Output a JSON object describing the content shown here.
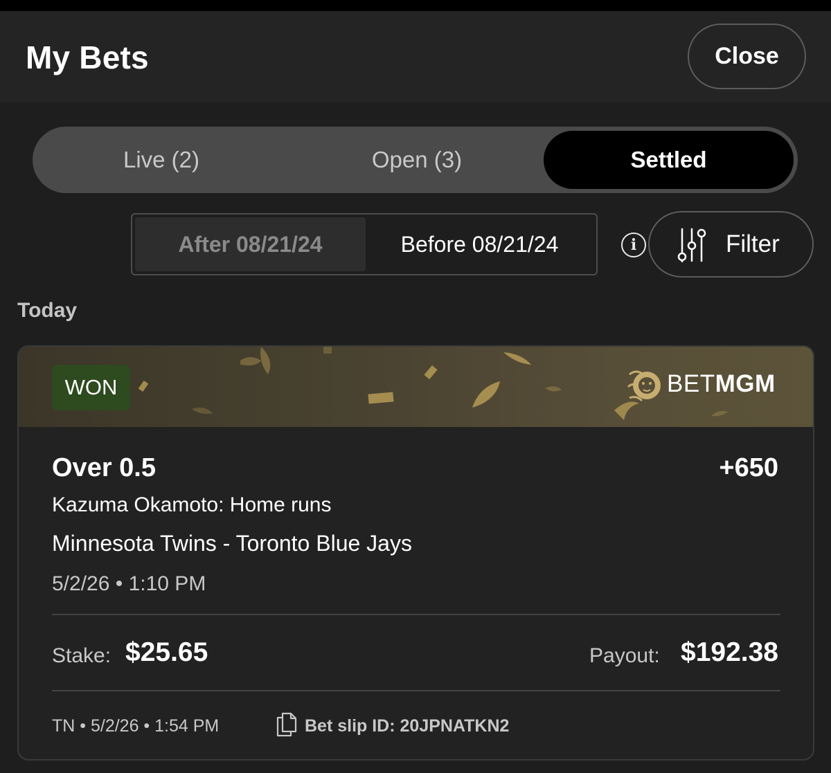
{
  "header": {
    "title": "My Bets",
    "close_label": "Close"
  },
  "tabs": [
    {
      "label": "Live (2)",
      "selected": false
    },
    {
      "label": "Open (3)",
      "selected": false
    },
    {
      "label": "Settled",
      "selected": true
    }
  ],
  "date_toggle": {
    "after_label": "After 08/21/24",
    "before_label": "Before 08/21/24",
    "selected": "before"
  },
  "filter": {
    "label": "Filter",
    "icon": "sliders-icon",
    "info_icon": "info-icon"
  },
  "section": {
    "label": "Today"
  },
  "bet": {
    "status": "WON",
    "brand": {
      "prefix": "BET",
      "suffix": "MGM",
      "icon": "lion-logo"
    },
    "selection": "Over 0.5",
    "odds": "+650",
    "market": "Kazuma Okamoto: Home runs",
    "event": "Minnesota Twins - Toronto Blue Jays",
    "event_time": "5/2/26 • 1:10 PM",
    "stake_label": "Stake:",
    "stake_value": "$25.65",
    "payout_label": "Payout:",
    "payout_value": "$192.38",
    "placed_info": "TN • 5/2/26 • 1:54 PM",
    "bet_slip_id": "Bet slip ID: 20JPNATKN2"
  },
  "colors": {
    "background": "#1e1e1e",
    "header": "#242424",
    "tab_track": "#4a4a4a",
    "tab_selected": "#000000",
    "won_badge": "#2e4a1f",
    "banner_gold": "#574e38",
    "confetti_gold": "#b59a55"
  }
}
